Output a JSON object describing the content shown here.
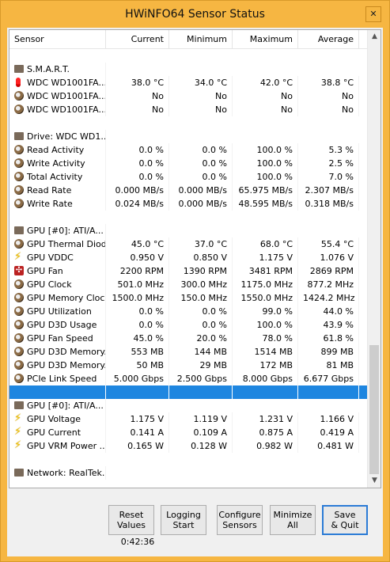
{
  "window": {
    "title": "HWiNFO64 Sensor Status",
    "close_glyph": "✕"
  },
  "columns": [
    "Sensor",
    "Current",
    "Minimum",
    "Maximum",
    "Average"
  ],
  "rows": [
    {
      "type": "blank"
    },
    {
      "type": "group",
      "icon": "drive-group-icon",
      "name": "S.M.A.R.T."
    },
    {
      "type": "data",
      "icon": "thermometer-icon",
      "name": "WDC WD1001FA...",
      "cur": "38.0 °C",
      "min": "34.0 °C",
      "max": "42.0 °C",
      "avg": "38.8 °C"
    },
    {
      "type": "data",
      "icon": "disk-icon",
      "name": "WDC WD1001FA...",
      "cur": "No",
      "min": "No",
      "max": "No",
      "avg": "No"
    },
    {
      "type": "data",
      "icon": "disk-icon",
      "name": "WDC WD1001FA...",
      "cur": "No",
      "min": "No",
      "max": "No",
      "avg": "No"
    },
    {
      "type": "blank"
    },
    {
      "type": "group",
      "icon": "drive-group-icon",
      "name": "Drive: WDC WD1..."
    },
    {
      "type": "data",
      "icon": "disk-icon",
      "name": "Read Activity",
      "cur": "0.0 %",
      "min": "0.0 %",
      "max": "100.0 %",
      "avg": "5.3 %"
    },
    {
      "type": "data",
      "icon": "disk-icon",
      "name": "Write Activity",
      "cur": "0.0 %",
      "min": "0.0 %",
      "max": "100.0 %",
      "avg": "2.5 %"
    },
    {
      "type": "data",
      "icon": "disk-icon",
      "name": "Total Activity",
      "cur": "0.0 %",
      "min": "0.0 %",
      "max": "100.0 %",
      "avg": "7.0 %"
    },
    {
      "type": "data",
      "icon": "disk-icon",
      "name": "Read Rate",
      "cur": "0.000 MB/s",
      "min": "0.000 MB/s",
      "max": "65.975 MB/s",
      "avg": "2.307 MB/s"
    },
    {
      "type": "data",
      "icon": "disk-icon",
      "name": "Write Rate",
      "cur": "0.024 MB/s",
      "min": "0.000 MB/s",
      "max": "48.595 MB/s",
      "avg": "0.318 MB/s"
    },
    {
      "type": "blank"
    },
    {
      "type": "group",
      "icon": "gpu-group-icon",
      "name": "GPU [#0]: ATI/A..."
    },
    {
      "type": "data",
      "icon": "disk-icon",
      "name": "GPU Thermal Diode",
      "cur": "45.0 °C",
      "min": "37.0 °C",
      "max": "68.0 °C",
      "avg": "55.4 °C"
    },
    {
      "type": "data",
      "icon": "lightning-icon",
      "name": "GPU VDDC",
      "cur": "0.950 V",
      "min": "0.850 V",
      "max": "1.175 V",
      "avg": "1.076 V"
    },
    {
      "type": "data",
      "icon": "fan-icon",
      "name": "GPU Fan",
      "cur": "2200 RPM",
      "min": "1390 RPM",
      "max": "3481 RPM",
      "avg": "2869 RPM"
    },
    {
      "type": "data",
      "icon": "disk-icon",
      "name": "GPU Clock",
      "cur": "501.0 MHz",
      "min": "300.0 MHz",
      "max": "1175.0 MHz",
      "avg": "877.2 MHz"
    },
    {
      "type": "data",
      "icon": "disk-icon",
      "name": "GPU Memory Clock",
      "cur": "1500.0 MHz",
      "min": "150.0 MHz",
      "max": "1550.0 MHz",
      "avg": "1424.2 MHz"
    },
    {
      "type": "data",
      "icon": "disk-icon",
      "name": "GPU Utilization",
      "cur": "0.0 %",
      "min": "0.0 %",
      "max": "99.0 %",
      "avg": "44.0 %"
    },
    {
      "type": "data",
      "icon": "disk-icon",
      "name": "GPU D3D Usage",
      "cur": "0.0 %",
      "min": "0.0 %",
      "max": "100.0 %",
      "avg": "43.9 %"
    },
    {
      "type": "data",
      "icon": "disk-icon",
      "name": "GPU Fan Speed",
      "cur": "45.0 %",
      "min": "20.0 %",
      "max": "78.0 %",
      "avg": "61.8 %"
    },
    {
      "type": "data",
      "icon": "disk-icon",
      "name": "GPU D3D Memory...",
      "cur": "553 MB",
      "min": "144 MB",
      "max": "1514 MB",
      "avg": "899 MB"
    },
    {
      "type": "data",
      "icon": "disk-icon",
      "name": "GPU D3D Memory...",
      "cur": "50 MB",
      "min": "29 MB",
      "max": "172 MB",
      "avg": "81 MB"
    },
    {
      "type": "data",
      "icon": "disk-icon",
      "name": "PCIe Link Speed",
      "cur": "5.000 Gbps",
      "min": "2.500 Gbps",
      "max": "8.000 Gbps",
      "avg": "6.677 Gbps"
    },
    {
      "type": "selected"
    },
    {
      "type": "group",
      "icon": "gpu-group-icon",
      "name": "GPU [#0]: ATI/A..."
    },
    {
      "type": "data",
      "icon": "lightning-icon",
      "name": "GPU Voltage",
      "cur": "1.175 V",
      "min": "1.119 V",
      "max": "1.231 V",
      "avg": "1.166 V"
    },
    {
      "type": "data",
      "icon": "lightning-icon",
      "name": "GPU Current",
      "cur": "0.141 A",
      "min": "0.109 A",
      "max": "0.875 A",
      "avg": "0.419 A"
    },
    {
      "type": "data",
      "icon": "lightning-icon",
      "name": "GPU VRM Power ...",
      "cur": "0.165 W",
      "min": "0.128 W",
      "max": "0.982 W",
      "avg": "0.481 W"
    },
    {
      "type": "blank"
    },
    {
      "type": "group",
      "icon": "network-group-icon",
      "name": "Network: RealTek..."
    }
  ],
  "buttons": {
    "reset": "Reset\nValues",
    "logging": "Logging\nStart",
    "configure": "Configure\nSensors",
    "minimize": "Minimize\nAll",
    "save_quit": "Save\n& Quit"
  },
  "timer": "0:42:36",
  "scrollbar": {
    "up_glyph": "▲",
    "down_glyph": "▼"
  },
  "colors": {
    "titlebar": "#f6b642",
    "selection": "#1e86e0"
  }
}
